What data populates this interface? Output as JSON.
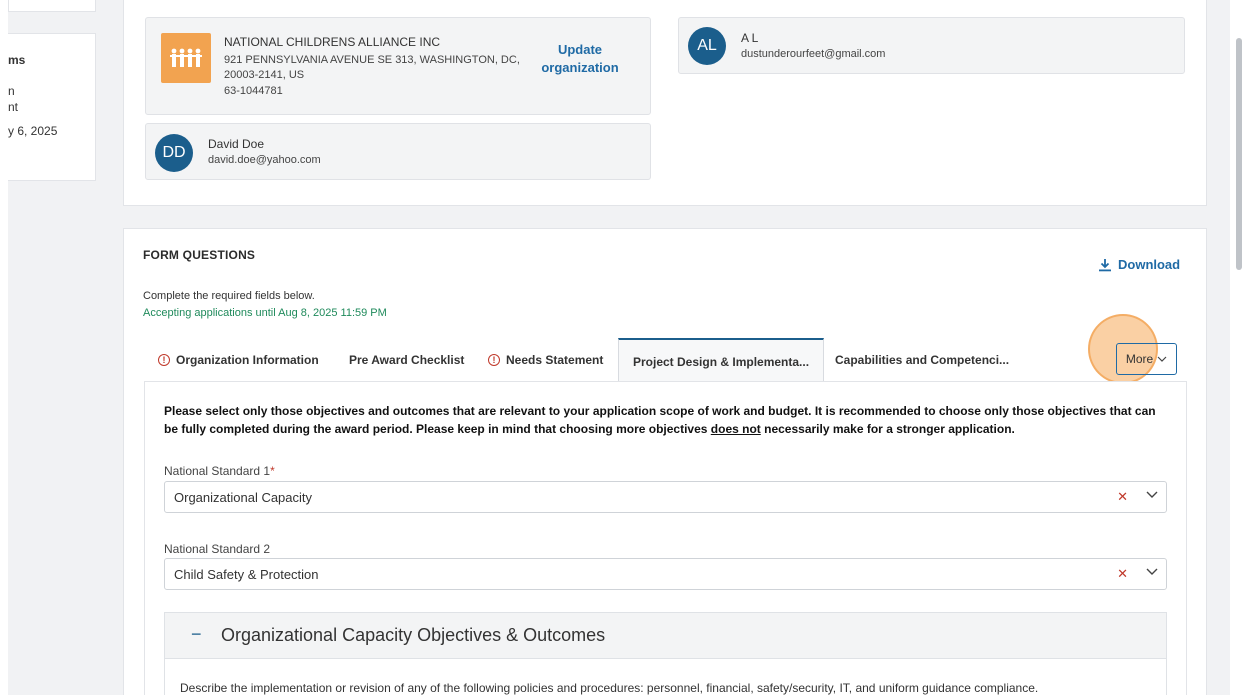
{
  "left_sidebar": {
    "title_fragment": "ms",
    "line1": "n",
    "line2": "nt",
    "line3": "y 6, 2025"
  },
  "organization": {
    "name": "NATIONAL CHILDRENS ALLIANCE INC",
    "address_line1": "921 PENNSYLVANIA AVENUE SE 313, WASHINGTON, DC,",
    "address_line2": "20003-2141, US",
    "ein": "63-1044781",
    "update_label_1": "Update",
    "update_label_2": "organization"
  },
  "applicant": {
    "initials": "AL",
    "name": "A L",
    "email": "dustunderourfeet@gmail.com"
  },
  "contact": {
    "initials": "DD",
    "name": "David Doe",
    "email": "david.doe@yahoo.com"
  },
  "form": {
    "title": "FORM QUESTIONS",
    "download_label": "Download",
    "subtext": "Complete the required fields below.",
    "accepting": "Accepting applications until Aug 8, 2025 11:59 PM",
    "tabs": [
      {
        "label": "Organization Information",
        "warning": true
      },
      {
        "label": "Pre Award Checklist",
        "warning": false
      },
      {
        "label": "Needs Statement",
        "warning": true
      },
      {
        "label": "Project Design & Implementa...",
        "warning": false,
        "active": true
      },
      {
        "label": "Capabilities and Competenci...",
        "warning": false
      }
    ],
    "more_label": "More",
    "notice_part1": "Please select only those objectives and outcomes that are relevant to your application scope of work and budget. It is recommended to choose only those objectives that can be fully completed during the award period. Please keep in mind that choosing more objectives ",
    "notice_underline": "does not",
    "notice_part2": " necessarily make for a stronger application.",
    "standard1_label": "National Standard 1",
    "standard1_required": "*",
    "standard1_value": "Organizational Capacity",
    "standard2_label": "National Standard 2",
    "standard2_value": "Child Safety & Protection",
    "accordion_title": "Organizational Capacity Objectives & Outcomes",
    "accordion_desc": "Describe the implementation or revision of any of the following policies and procedures: personnel, financial, safety/security, IT, and uniform guidance compliance."
  },
  "colors": {
    "accent": "#1f6aa5",
    "avatar": "#1b5e8c",
    "success": "#1f8a5b",
    "warning": "#c0392b",
    "org_logo": "#f2a350"
  }
}
